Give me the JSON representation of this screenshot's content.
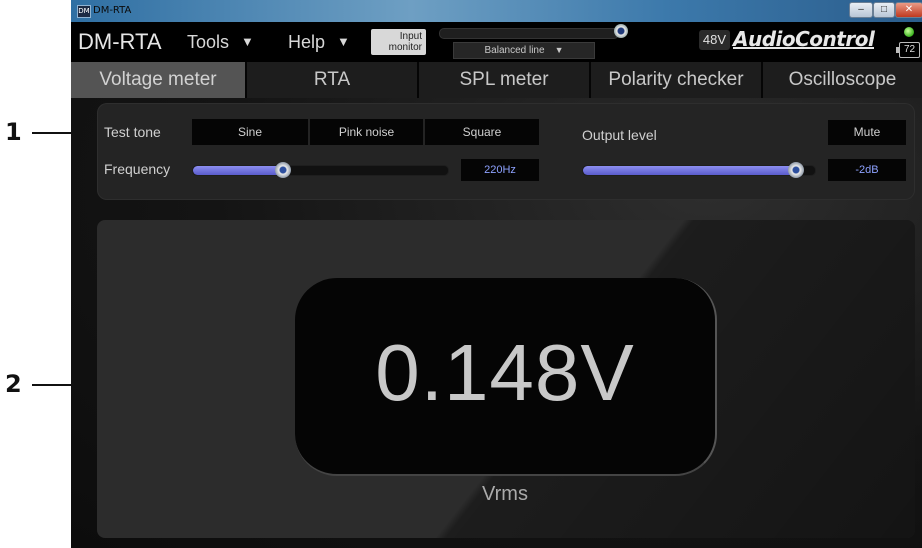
{
  "callouts": [
    "1",
    "2"
  ],
  "window": {
    "title": "DM-RTA",
    "icon_label": "DM",
    "controls": [
      "minimize-icon",
      "maximize-icon",
      "close-icon"
    ]
  },
  "menubar": {
    "app_name": "DM-RTA",
    "tools": "Tools",
    "help": "Help",
    "input_monitor_line1": "Input",
    "input_monitor_line2": "monitor",
    "source_select": "Balanced line",
    "phantom_power": "48V",
    "brand": "AudioControl",
    "battery": "72",
    "status_color": "#39b21e"
  },
  "tabs": [
    {
      "label": "Voltage meter",
      "active": true
    },
    {
      "label": "RTA",
      "active": false
    },
    {
      "label": "SPL meter",
      "active": false
    },
    {
      "label": "Polarity checker",
      "active": false
    },
    {
      "label": "Oscilloscope",
      "active": false
    }
  ],
  "tone_panel": {
    "test_tone_label": "Test tone",
    "tone_buttons": [
      "Sine",
      "Pink noise",
      "Square"
    ],
    "frequency_label": "Frequency",
    "frequency_value": "220Hz",
    "frequency_slider_fraction": 0.36,
    "output_level_label": "Output level",
    "mute_label": "Mute",
    "output_value": "-2dB",
    "output_slider_fraction": 0.93
  },
  "meter": {
    "reading": "0.148V",
    "unit": "Vrms"
  },
  "colors": {
    "accent_slider": "#6d6fe0",
    "value_text": "#8ea2ff",
    "active_tab": "#545454"
  }
}
